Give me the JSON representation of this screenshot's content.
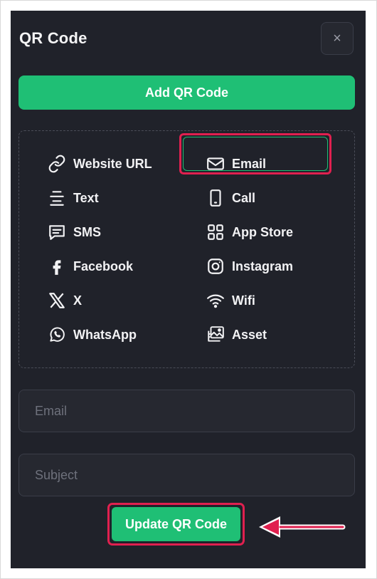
{
  "panel": {
    "title": "QR Code",
    "close_label": "×",
    "add_button": "Add QR Code"
  },
  "types": [
    {
      "label": "Website URL",
      "icon": "link-icon"
    },
    {
      "label": "Email",
      "icon": "envelope-icon",
      "selected": true
    },
    {
      "label": "Text",
      "icon": "text-align-icon"
    },
    {
      "label": "Call",
      "icon": "phone-icon"
    },
    {
      "label": "SMS",
      "icon": "message-icon"
    },
    {
      "label": "App Store",
      "icon": "grid-icon"
    },
    {
      "label": "Facebook",
      "icon": "facebook-icon"
    },
    {
      "label": "Instagram",
      "icon": "instagram-icon"
    },
    {
      "label": "X",
      "icon": "x-logo-icon"
    },
    {
      "label": "Wifi",
      "icon": "wifi-icon"
    },
    {
      "label": "WhatsApp",
      "icon": "whatsapp-icon"
    },
    {
      "label": "Asset",
      "icon": "images-icon"
    }
  ],
  "form": {
    "email_placeholder": "Email",
    "subject_placeholder": "Subject"
  },
  "update_button": "Update QR Code",
  "colors": {
    "accent": "#1fbf75",
    "panel_bg": "#20222a",
    "highlight": "#e0204f"
  }
}
